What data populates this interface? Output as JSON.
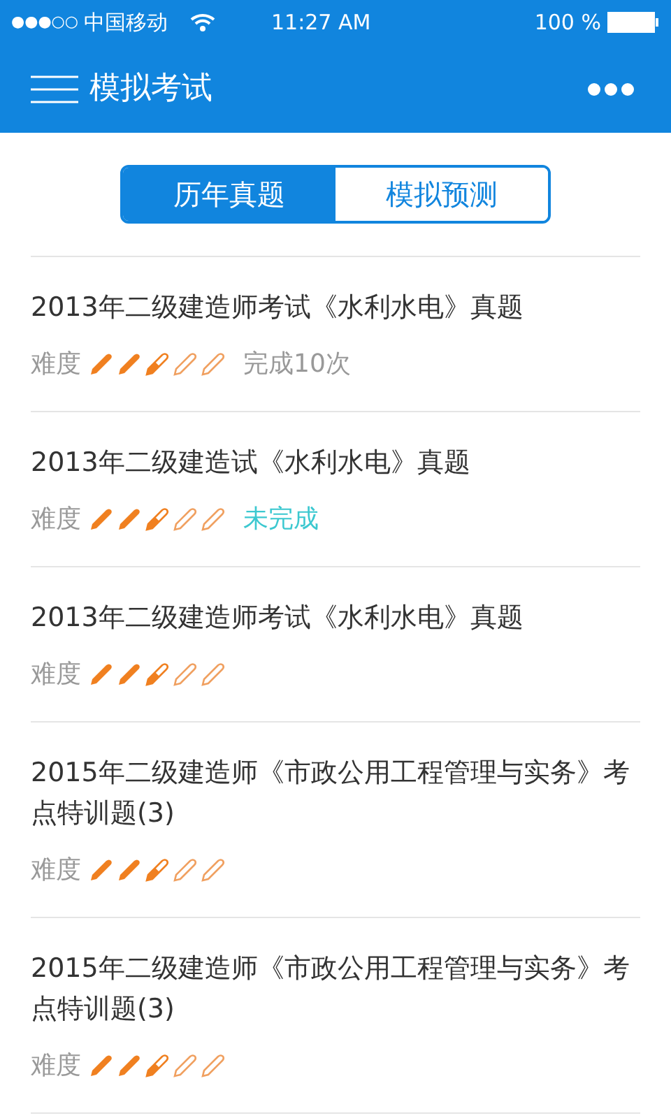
{
  "status_bar": {
    "signal_dots": "●●●○○",
    "carrier": "中国移动",
    "time": "11:27 AM",
    "battery": "100 %"
  },
  "header": {
    "title": "模拟考试"
  },
  "tabs": [
    {
      "label": "历年真题",
      "selected": true
    },
    {
      "label": "模拟预测",
      "selected": false
    }
  ],
  "exams": [
    {
      "title": "2013年二级建造师考试《水利水电》真题",
      "difficulty_label": "难度",
      "stars": 2.5,
      "status": {
        "kind": "done",
        "text": "完成10次"
      }
    },
    {
      "title": "2013年二级建造试《水利水电》真题",
      "difficulty_label": "难度",
      "stars": 2.5,
      "status": {
        "kind": "pending",
        "text": "未完成"
      }
    },
    {
      "title": "2013年二级建造师考试《水利水电》真题",
      "difficulty_label": "难度",
      "stars": 2.5
    },
    {
      "title": "2015年二级建造师《市政公用工程管理与实务》考点特训题(3)",
      "difficulty_label": "难度",
      "stars": 2.5
    },
    {
      "title": "2015年二级建造师《市政公用工程管理与实务》考点特训题(3)",
      "difficulty_label": "难度",
      "stars": 2.5
    }
  ]
}
